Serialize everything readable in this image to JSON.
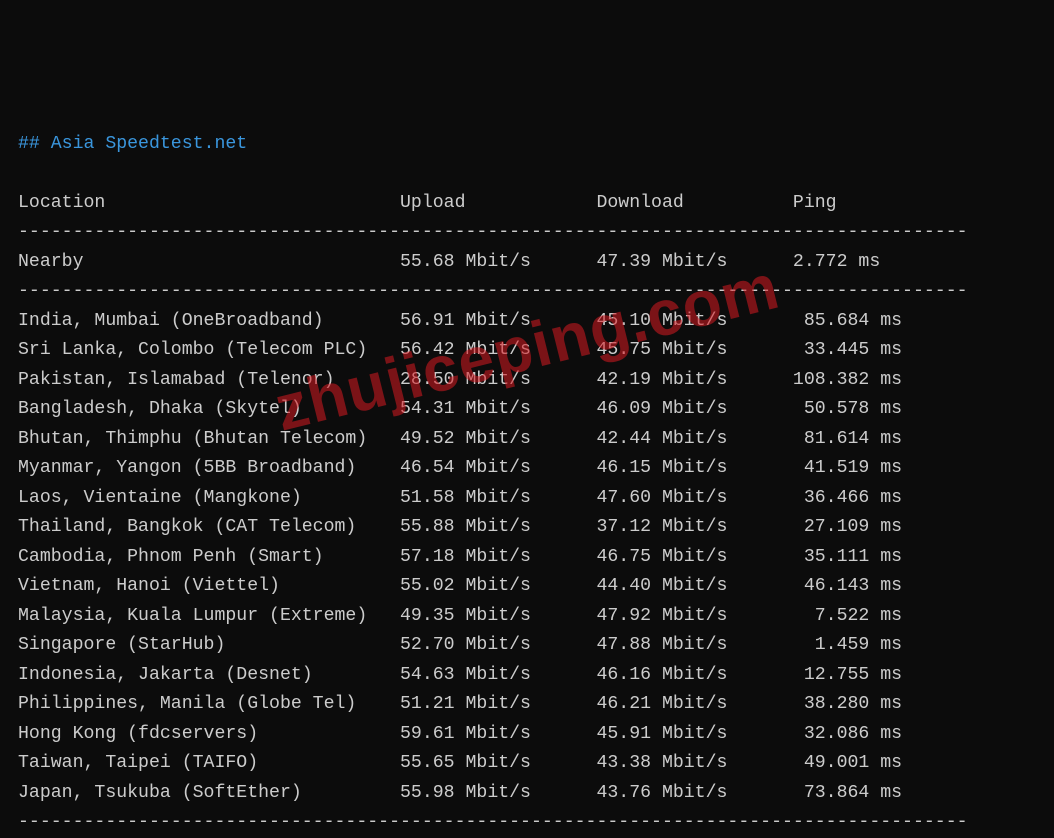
{
  "title": "## Asia Speedtest.net",
  "watermark": "zhujiceping.com",
  "header": {
    "location": "Location",
    "upload": "Upload",
    "download": "Download",
    "ping": "Ping"
  },
  "divider": "---------------------------------------------------------------------------------------",
  "nearby": {
    "label": "Nearby",
    "upload": "55.68 Mbit/s",
    "download": "47.39 Mbit/s",
    "ping": "2.772 ms"
  },
  "rows": [
    {
      "location": "India, Mumbai (OneBroadband)",
      "upload": "56.91 Mbit/s",
      "download": "45.10 Mbit/s",
      "ping": " 85.684 ms"
    },
    {
      "location": "Sri Lanka, Colombo (Telecom PLC)",
      "upload": "56.42 Mbit/s",
      "download": "45.75 Mbit/s",
      "ping": " 33.445 ms"
    },
    {
      "location": "Pakistan, Islamabad (Telenor)",
      "upload": "28.50 Mbit/s",
      "download": "42.19 Mbit/s",
      "ping": "108.382 ms"
    },
    {
      "location": "Bangladesh, Dhaka (Skytel)",
      "upload": "54.31 Mbit/s",
      "download": "46.09 Mbit/s",
      "ping": " 50.578 ms"
    },
    {
      "location": "Bhutan, Thimphu (Bhutan Telecom)",
      "upload": "49.52 Mbit/s",
      "download": "42.44 Mbit/s",
      "ping": " 81.614 ms"
    },
    {
      "location": "Myanmar, Yangon (5BB Broadband)",
      "upload": "46.54 Mbit/s",
      "download": "46.15 Mbit/s",
      "ping": " 41.519 ms"
    },
    {
      "location": "Laos, Vientaine (Mangkone)",
      "upload": "51.58 Mbit/s",
      "download": "47.60 Mbit/s",
      "ping": " 36.466 ms"
    },
    {
      "location": "Thailand, Bangkok (CAT Telecom)",
      "upload": "55.88 Mbit/s",
      "download": "37.12 Mbit/s",
      "ping": " 27.109 ms"
    },
    {
      "location": "Cambodia, Phnom Penh (Smart)",
      "upload": "57.18 Mbit/s",
      "download": "46.75 Mbit/s",
      "ping": " 35.111 ms"
    },
    {
      "location": "Vietnam, Hanoi (Viettel)",
      "upload": "55.02 Mbit/s",
      "download": "44.40 Mbit/s",
      "ping": " 46.143 ms"
    },
    {
      "location": "Malaysia, Kuala Lumpur (Extreme)",
      "upload": "49.35 Mbit/s",
      "download": "47.92 Mbit/s",
      "ping": "  7.522 ms"
    },
    {
      "location": "Singapore (StarHub)",
      "upload": "52.70 Mbit/s",
      "download": "47.88 Mbit/s",
      "ping": "  1.459 ms"
    },
    {
      "location": "Indonesia, Jakarta (Desnet)",
      "upload": "54.63 Mbit/s",
      "download": "46.16 Mbit/s",
      "ping": " 12.755 ms"
    },
    {
      "location": "Philippines, Manila (Globe Tel)",
      "upload": "51.21 Mbit/s",
      "download": "46.21 Mbit/s",
      "ping": " 38.280 ms"
    },
    {
      "location": "Hong Kong (fdcservers)",
      "upload": "59.61 Mbit/s",
      "download": "45.91 Mbit/s",
      "ping": " 32.086 ms"
    },
    {
      "location": "Taiwan, Taipei (TAIFO)",
      "upload": "55.65 Mbit/s",
      "download": "43.38 Mbit/s",
      "ping": " 49.001 ms"
    },
    {
      "location": "Japan, Tsukuba (SoftEther)",
      "upload": "55.98 Mbit/s",
      "download": "43.76 Mbit/s",
      "ping": " 73.864 ms"
    }
  ]
}
